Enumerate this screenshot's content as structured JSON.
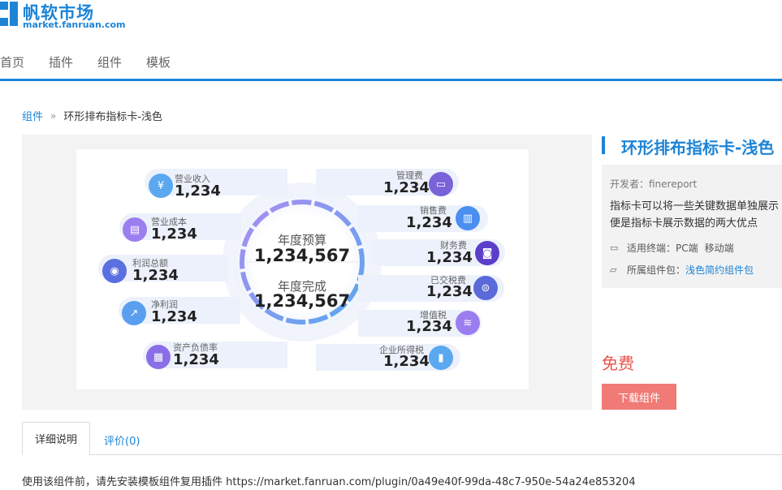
{
  "header": {
    "logo_title": "帆软市场",
    "logo_url": "market.fanruan.com",
    "nav": [
      "首页",
      "插件",
      "组件",
      "模板"
    ]
  },
  "breadcrumb": {
    "parent": "组件",
    "separator": "»",
    "current": "环形排布指标卡-浅色"
  },
  "preview": {
    "center": {
      "budget_label": "年度预算",
      "budget_value": "1,234,567",
      "done_label": "年度完成",
      "done_value": "1,234,567"
    },
    "left": [
      {
        "label": "营业收入",
        "value": "1,234",
        "icon": "money-bag-icon",
        "color": "#5aa8f0"
      },
      {
        "label": "营业成本",
        "value": "1,234",
        "icon": "cost-doc-icon",
        "color": "#9b7ff0"
      },
      {
        "label": "利润总额",
        "value": "1,234",
        "icon": "profit-coin-icon",
        "color": "#5a6fe0"
      },
      {
        "label": "净利润",
        "value": "1,234",
        "icon": "chart-icon",
        "color": "#5a9ef0"
      },
      {
        "label": "资产负债率",
        "value": "1,234",
        "icon": "ledger-icon",
        "color": "#8a6ee8"
      }
    ],
    "right": [
      {
        "label": "管理费",
        "value": "1,234",
        "icon": "manage-icon",
        "color": "#7a62d8"
      },
      {
        "label": "销售费",
        "value": "1,234",
        "icon": "bar-chart-icon",
        "color": "#4a8ff0"
      },
      {
        "label": "财务费",
        "value": "1,234",
        "icon": "finance-icon",
        "color": "#5b3fc8"
      },
      {
        "label": "已交税费",
        "value": "1,234",
        "icon": "tax-icon",
        "color": "#5a6ad8"
      },
      {
        "label": "增值税",
        "value": "1,234",
        "icon": "coins-icon",
        "color": "#9a7ef0"
      },
      {
        "label": "企业所得税",
        "value": "1,234",
        "icon": "income-tax-icon",
        "color": "#5aa8f0"
      }
    ]
  },
  "product": {
    "title": "环形排布指标卡-浅色",
    "developer": "开发者：finereport",
    "description": "指标卡可以将一些关键数据单独展示便是指标卡展示数据的两大优点",
    "terminal_label": "适用终端：PC端",
    "terminal_mobile": "移动端",
    "package_label": "所属组件包：",
    "package_link": "浅色简约组件包",
    "price": "免费",
    "download": "下载组件"
  },
  "tabs": {
    "detail": "详细说明",
    "reviews": "评价(0)"
  },
  "notice": "使用该组件前，请先安装模板组件复用插件 https://market.fanruan.com/plugin/0a49e40f-99da-48c7-950e-54a24e853204"
}
